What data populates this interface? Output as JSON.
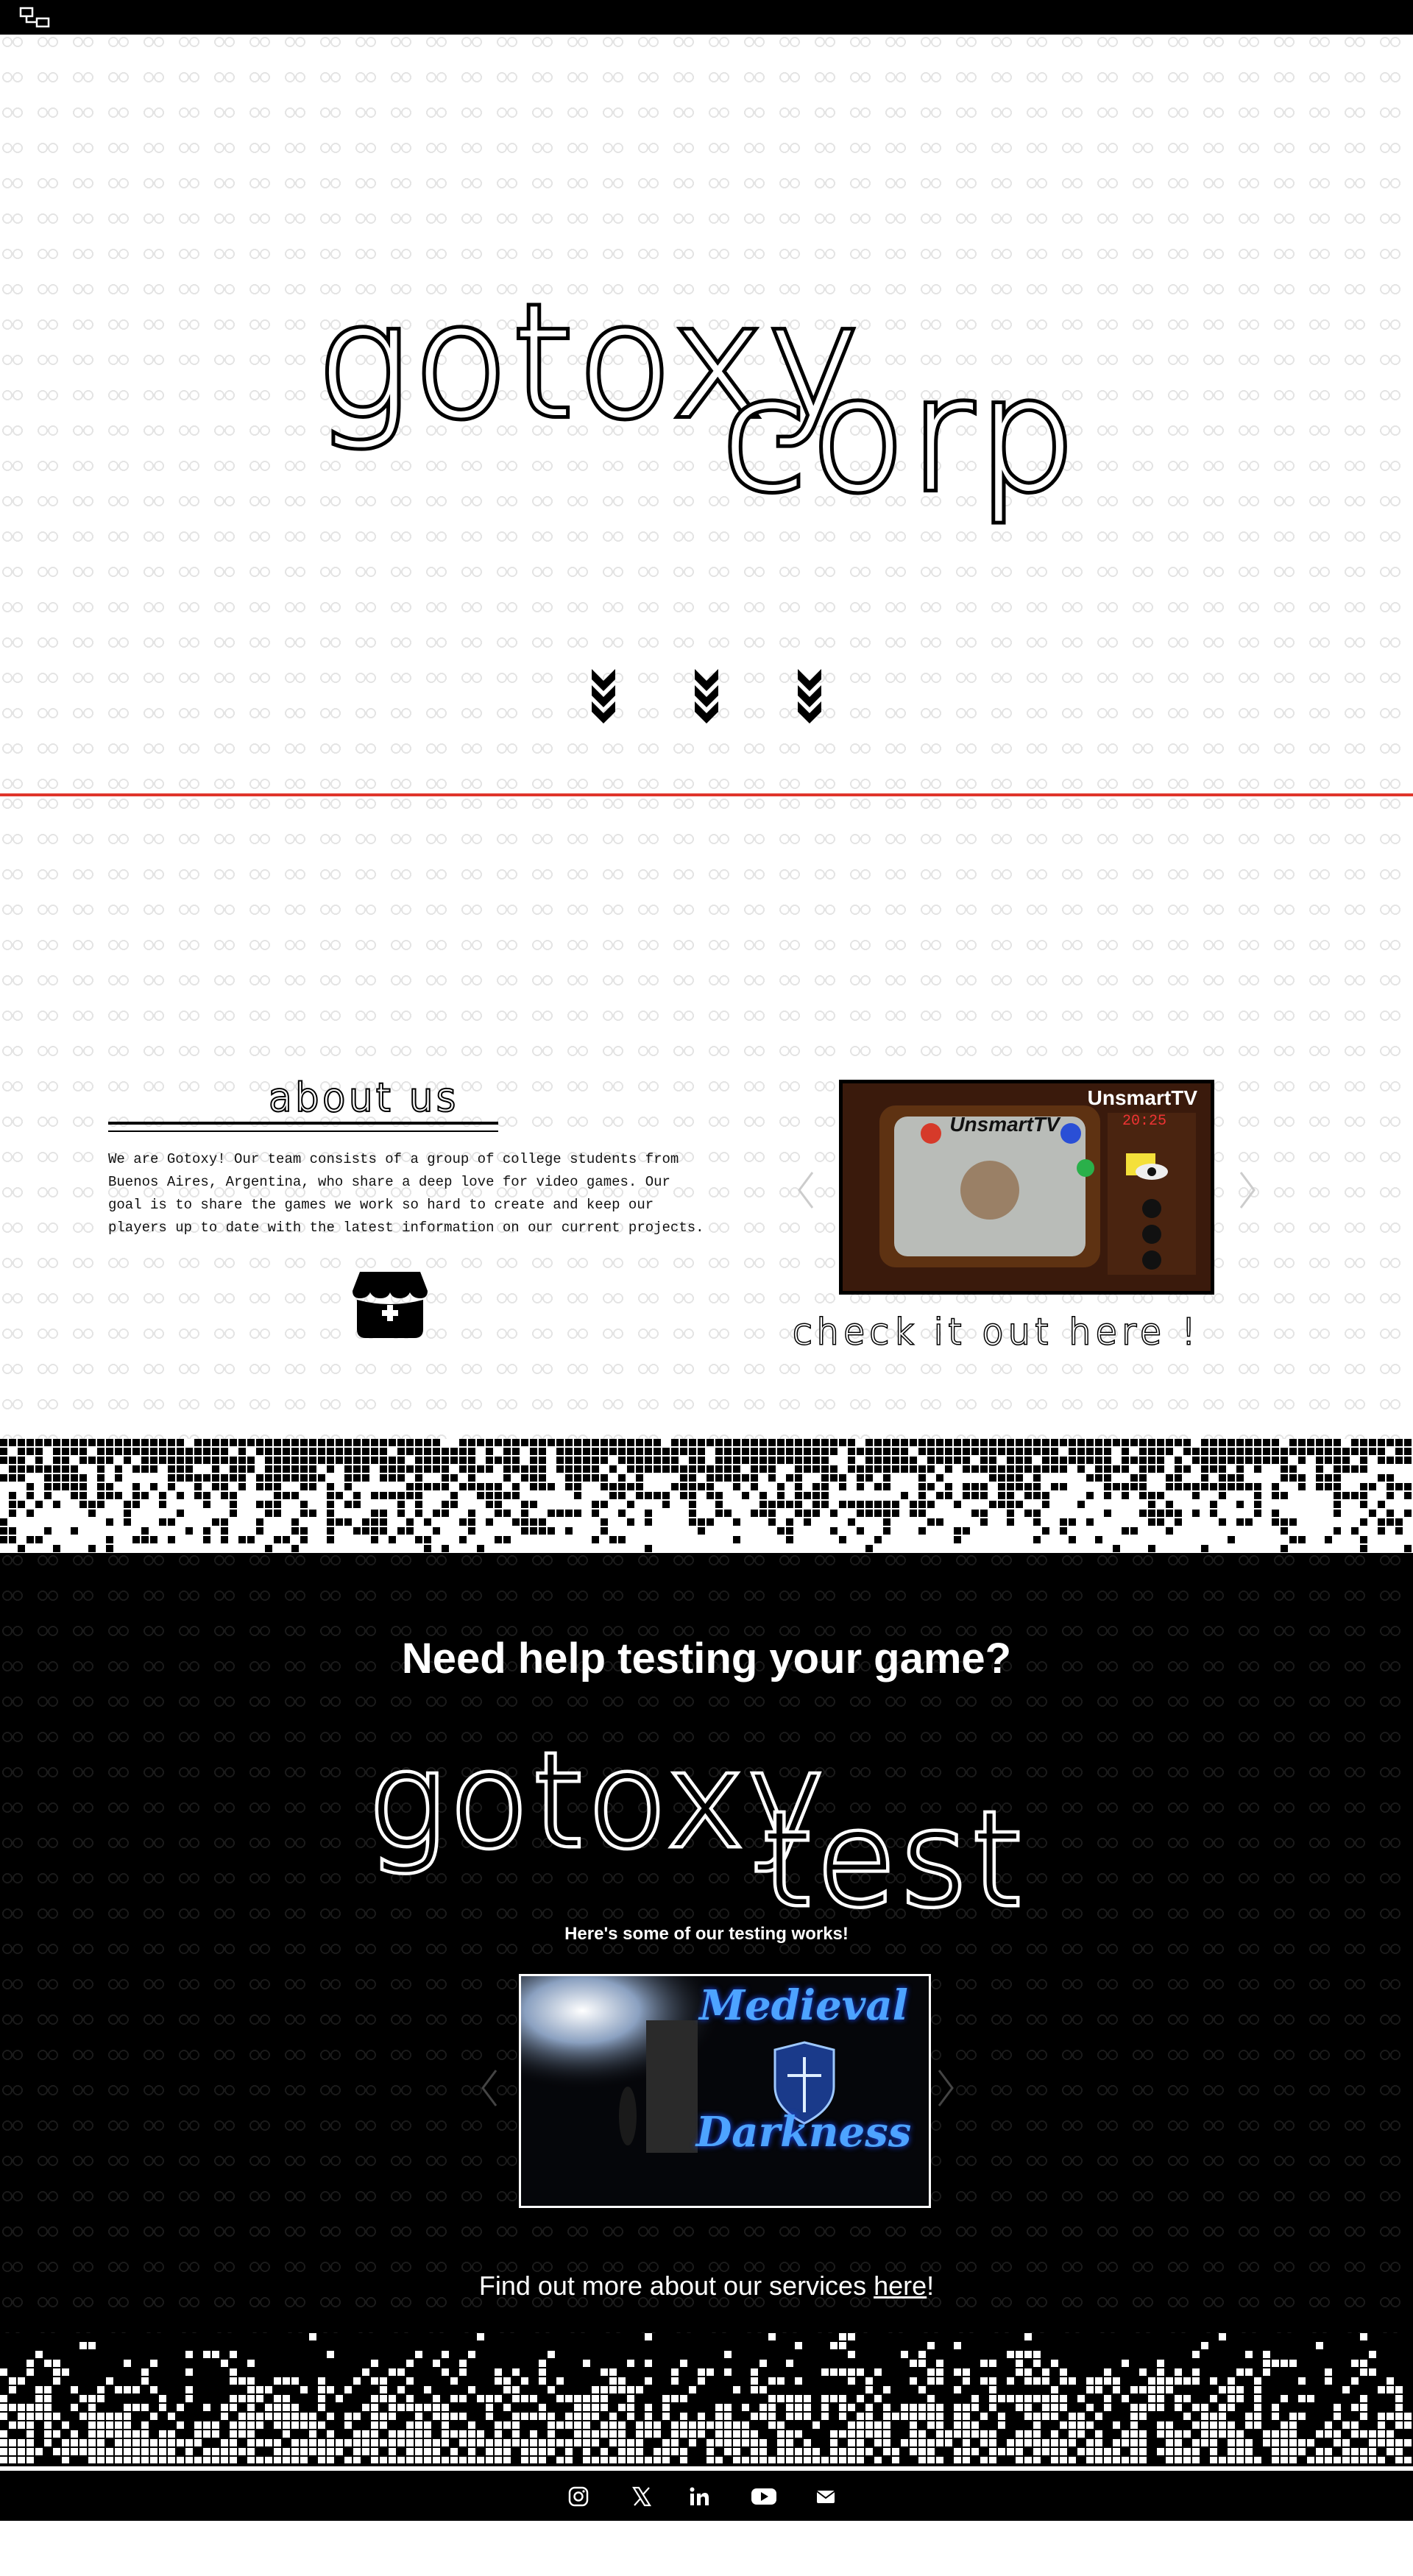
{
  "hero": {
    "title_line1": "gotoxy",
    "title_line2": "corp"
  },
  "about": {
    "heading": "about us",
    "body": "We are Gotoxy! Our team consists of a group of college students from Buenos Aires, Argentina, who share a deep love for video games. Our goal is to share the games we work so hard to create and keep our players up to date with the latest information on our current projects.",
    "featured_game": {
      "label": "UnsmartTV",
      "brand": "UnsmartTV",
      "date": "20:25"
    },
    "cta": "check it out here !"
  },
  "testing": {
    "heading": "Need help testing your game?",
    "title_line1": "gotoxy",
    "title_line2": "test",
    "caption": "Here's some of our testing works!",
    "featured_work": {
      "title_line1": "Medieval",
      "title_line2": "Darkness"
    },
    "find_more_prefix": "Find out more about our services ",
    "find_more_link": "here",
    "find_more_suffix": "!"
  },
  "colors": {
    "accent_line": "#e0352b",
    "background_dark": "#000000",
    "background_light": "#ffffff"
  },
  "icons": {
    "logo": "gotoxy-logo-icon",
    "scroll": "chevron-double-down-icon",
    "store": "itch-store-icon",
    "social": [
      "instagram-icon",
      "x-icon",
      "linkedin-icon",
      "youtube-icon",
      "mail-icon"
    ]
  }
}
